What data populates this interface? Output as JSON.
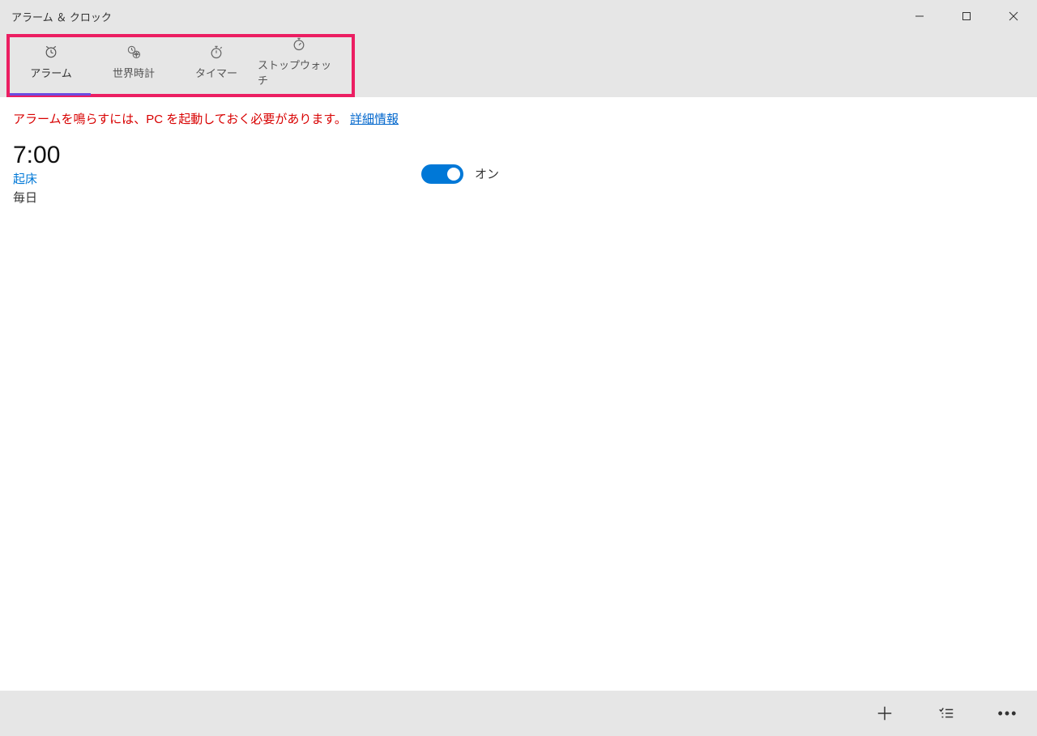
{
  "title": "アラーム ＆ クロック",
  "tabs": [
    {
      "label": "アラーム",
      "icon": "alarm"
    },
    {
      "label": "世界時計",
      "icon": "world"
    },
    {
      "label": "タイマー",
      "icon": "timer"
    },
    {
      "label": "ストップウォッチ",
      "icon": "stopwatch"
    }
  ],
  "notice": {
    "text": "アラームを鳴らすには、PC を起動しておく必要があります。",
    "link": "詳細情報"
  },
  "alarm": {
    "time": "7:00",
    "name": "起床",
    "repeat": "毎日",
    "toggle_label": "オン"
  }
}
